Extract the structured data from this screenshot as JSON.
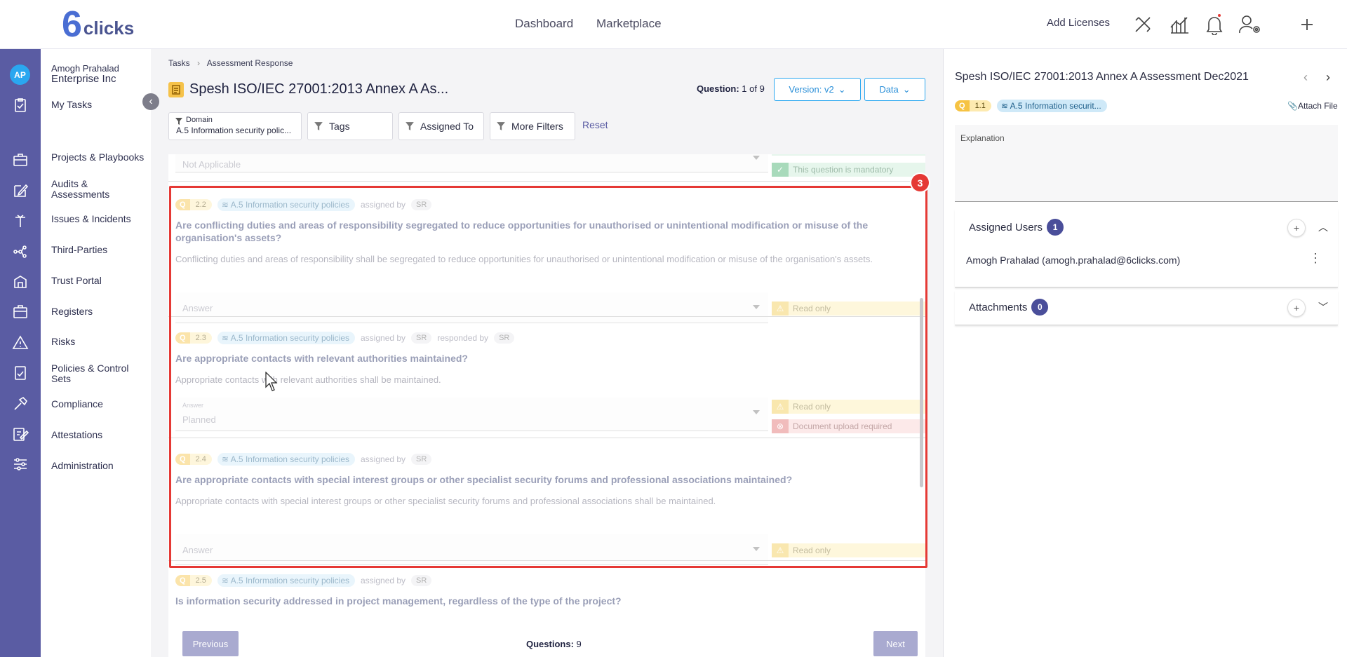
{
  "brand": {
    "mark": "6",
    "word": "clicks"
  },
  "topnav": {
    "dashboard": "Dashboard",
    "marketplace": "Marketplace",
    "add_licenses": "Add Licenses"
  },
  "rail": {
    "avatar": "AP"
  },
  "menu": {
    "user_name": "Amogh Prahalad",
    "org": "Enterprise Inc",
    "items": [
      "My Tasks",
      "Projects & Playbooks",
      "Audits & Assessments",
      "Issues & Incidents",
      "Third-Parties",
      "Trust Portal",
      "Registers",
      "Risks",
      "Policies & Control Sets",
      "Compliance",
      "Attestations",
      "Administration"
    ]
  },
  "breadcrumb": {
    "first": "Tasks",
    "second": "Assessment Response"
  },
  "page": {
    "title": "Spesh ISO/IEC 27001:2013 Annex A As...",
    "question_label": "Question:",
    "question_value": "1 of 9",
    "version": "Version: v2",
    "data": "Data"
  },
  "filters": {
    "domain_label": "Domain",
    "domain_value": "A.5 Information security polic...",
    "tags": "Tags",
    "assigned": "Assigned To",
    "more": "More Filters",
    "reset": "Reset"
  },
  "prev_item": {
    "answer": "Not Applicable",
    "mandatory": "This question is mandatory"
  },
  "questions": [
    {
      "tag": "Q",
      "num": "2.2",
      "domain": "A.5 Information security policies",
      "assigned_by": "assigned by",
      "assigned_init": "SR",
      "title": "Are conflicting duties and areas of responsibility segregated to reduce opportunities for unauthorised or unintentional modification or misuse of the organisation's assets?",
      "desc": "Conflicting duties and areas of responsibility shall be segregated to reduce opportunities for unauthorised or unintentional modification or misuse of the organisation's assets.",
      "answer": "Answer",
      "badge": "Read only"
    },
    {
      "tag": "Q",
      "num": "2.3",
      "domain": "A.5 Information security policies",
      "assigned_by": "assigned by",
      "assigned_init": "SR",
      "responded_by": "responded by",
      "responded_init": "SR",
      "title": "Are appropriate contacts with relevant authorities maintained?",
      "desc": "Appropriate contacts with relevant authorities shall be maintained.",
      "answer_label": "Answer",
      "answer": "Planned",
      "badge": "Read only",
      "badge2": "Document upload required"
    },
    {
      "tag": "Q",
      "num": "2.4",
      "domain": "A.5 Information security policies",
      "assigned_by": "assigned by",
      "assigned_init": "SR",
      "title": "Are appropriate contacts with special interest groups or other specialist security forums and professional associations maintained?",
      "desc": "Appropriate contacts with special interest groups or other specialist security forums and professional associations shall be maintained.",
      "answer": "Answer",
      "badge": "Read only"
    },
    {
      "tag": "Q",
      "num": "2.5",
      "domain": "A.5 Information security policies",
      "assigned_by": "assigned by",
      "assigned_init": "SR",
      "title": "Is information security addressed in project management, regardless of the type of the project?"
    }
  ],
  "footer": {
    "previous": "Previous",
    "questions_label": "Questions:",
    "questions_value": "9",
    "next": "Next"
  },
  "annotation": {
    "number": "3",
    "color": "#e53935"
  },
  "right": {
    "title": "Spesh ISO/IEC 27001:2013 Annex A Assessment Dec2021",
    "q_tag": "Q",
    "q_num": "1.1",
    "domain": "A.5 Information securit...",
    "attach": "Attach File",
    "explanation": "Explanation",
    "assigned_users": "Assigned Users",
    "assigned_count": "1",
    "user_entry": "Amogh Prahalad (amogh.prahalad@6clicks.com)",
    "attachments": "Attachments",
    "attachments_count": "0"
  },
  "colors": {
    "rail": "#5a5ca3",
    "accent": "#2aa7f0",
    "warning": "#f2c94c",
    "error": "#e06a6a"
  }
}
